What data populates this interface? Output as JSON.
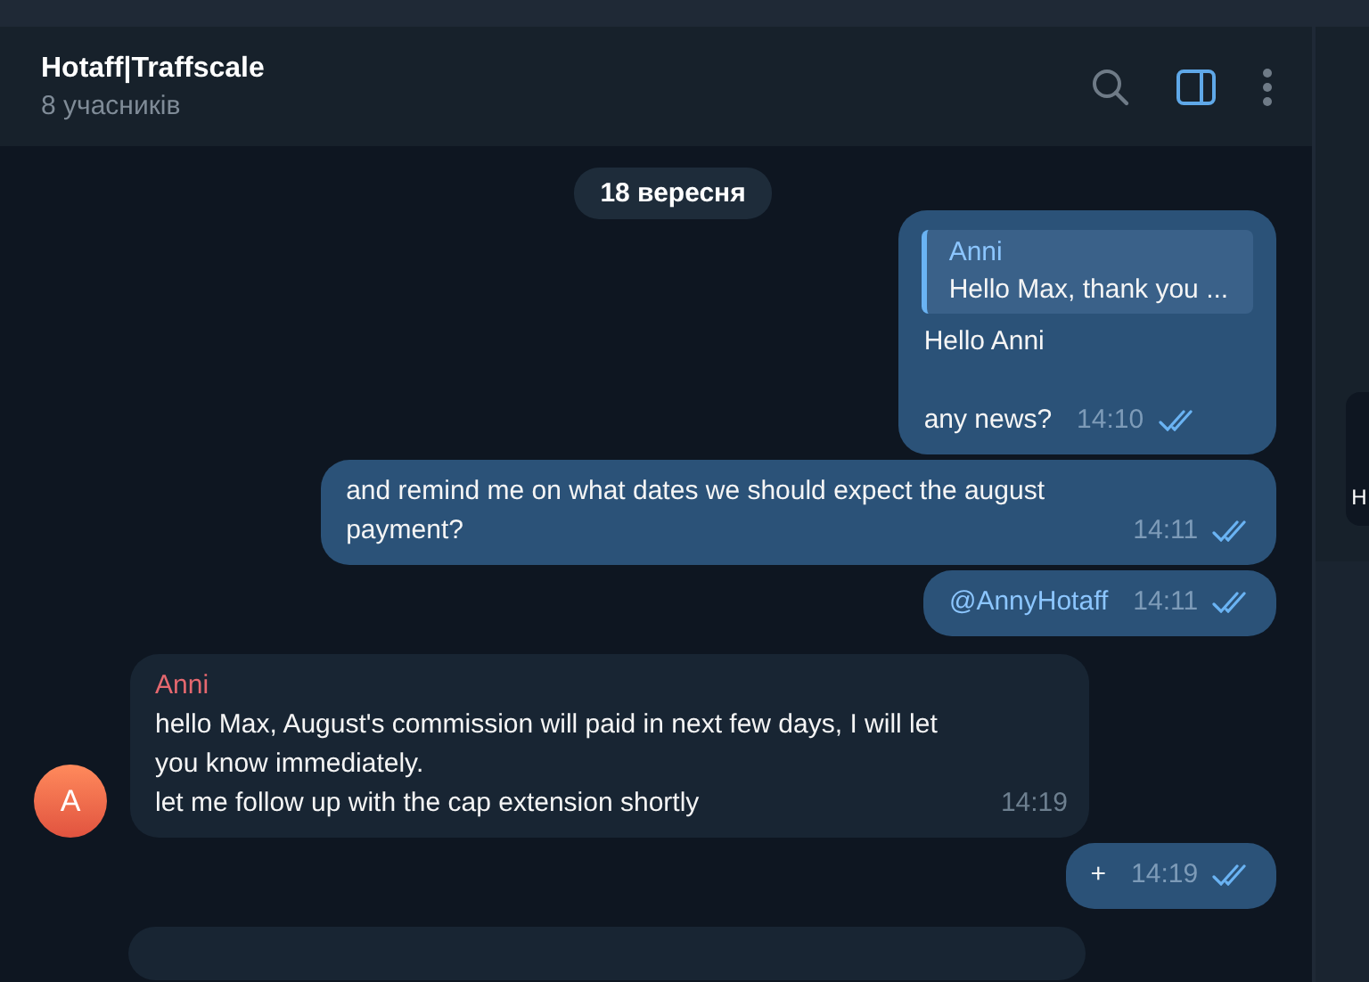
{
  "header": {
    "title": "Hotaff|Traffscale",
    "subtitle": "8 учасників",
    "side_panel_open": true
  },
  "date_separator": "18 вересня",
  "messages": [
    {
      "kind": "outgoing",
      "reply": {
        "author": "Anni",
        "text": "Hello Max, thank you ..."
      },
      "text": "Hello Anni\n\nany news?",
      "time": "14:10",
      "read": true
    },
    {
      "kind": "outgoing",
      "text": "and remind me on what dates we should expect the august payment?",
      "time": "14:11",
      "read": true
    },
    {
      "kind": "outgoing",
      "text": "@AnnyHotaff",
      "link": true,
      "time": "14:11",
      "read": true
    },
    {
      "kind": "incoming",
      "author": "Anni",
      "avatar": "A",
      "text": "hello Max, August's commission will paid in next few days, I will let you know immediately.\nlet me follow up with the cap extension shortly",
      "time": "14:19"
    },
    {
      "kind": "outgoing",
      "text": "+",
      "time": "14:19",
      "read": true
    },
    {
      "kind": "incoming_partial"
    }
  ],
  "side_panel": {
    "card_text": "H"
  }
}
